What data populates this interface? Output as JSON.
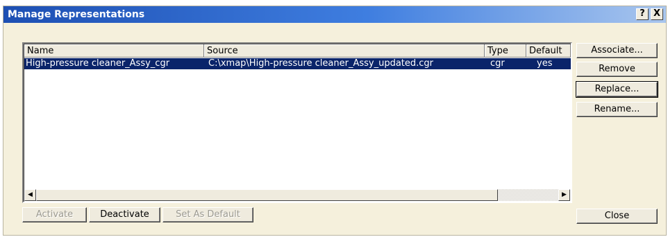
{
  "window": {
    "title": "Manage Representations",
    "help_label": "?",
    "close_label": "X"
  },
  "table": {
    "columns": [
      "Name",
      "Source",
      "Type",
      "Default"
    ],
    "rows": [
      {
        "name": "High-pressure cleaner_Assy_cgr",
        "source": "C:\\xmap\\High-pressure cleaner_Assy_updated.cgr",
        "type": "cgr",
        "default": "yes",
        "selected": true
      }
    ]
  },
  "side_buttons": {
    "associate": "Associate...",
    "remove": "Remove",
    "replace": "Replace...",
    "rename": "Rename...",
    "close": "Close"
  },
  "bottom_buttons": {
    "activate": "Activate",
    "deactivate": "Deactivate",
    "set_default": "Set As Default"
  },
  "scrollbar": {
    "left_arrow": "◀",
    "right_arrow": "▶"
  },
  "colors": {
    "dialog_bg": "#f5f0dc",
    "selection": "#0a246a",
    "titlebar_start": "#1d4fb3"
  }
}
